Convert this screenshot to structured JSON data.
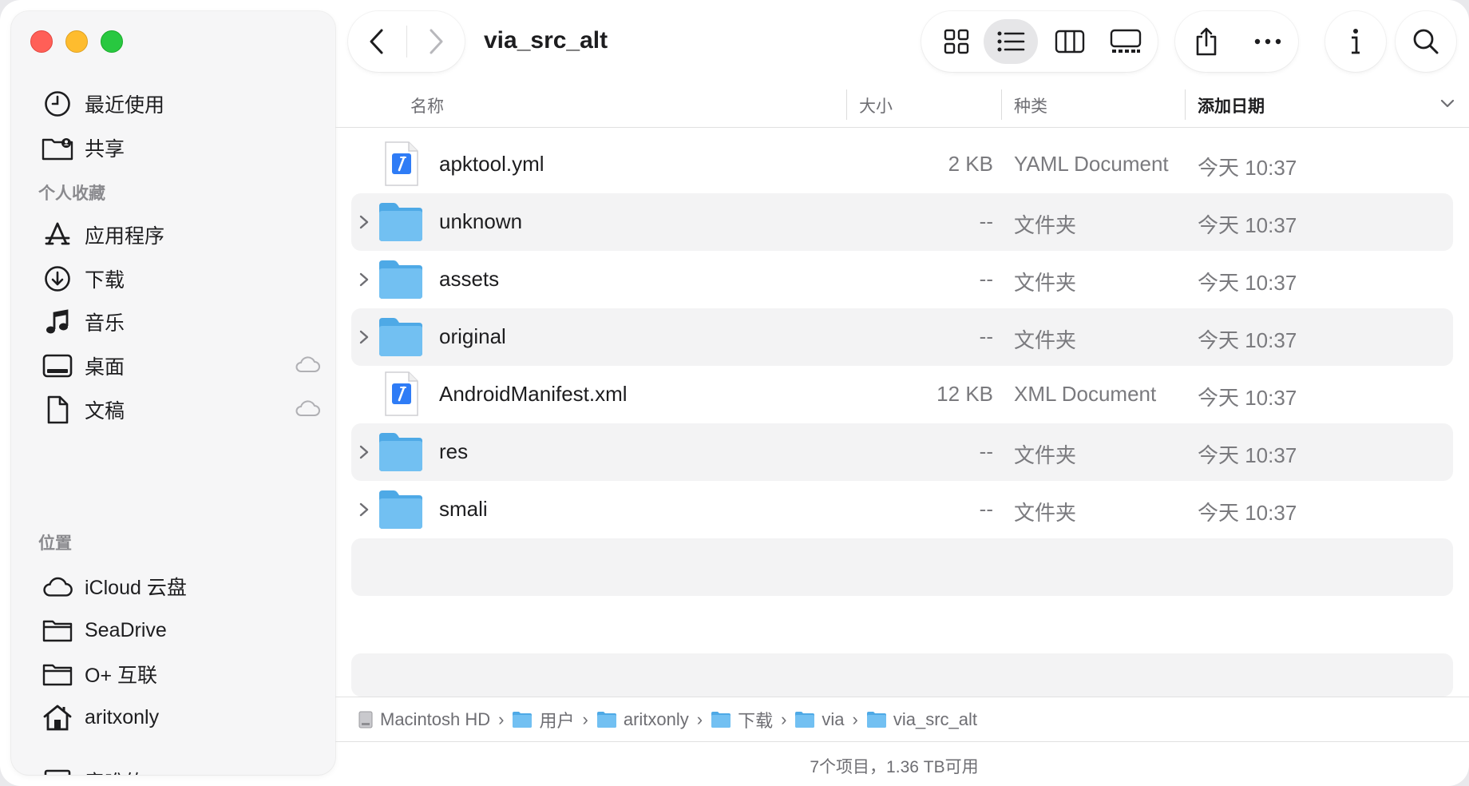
{
  "window": {
    "title": "via_src_alt"
  },
  "sidebar": {
    "top_items": [
      {
        "label": "最近使用",
        "icon": "clock-icon"
      },
      {
        "label": "共享",
        "icon": "shared-folder-icon"
      }
    ],
    "favorites_heading": "个人收藏",
    "favorites": [
      {
        "label": "应用程序",
        "icon": "applications-icon"
      },
      {
        "label": "下载",
        "icon": "download-icon"
      },
      {
        "label": "音乐",
        "icon": "music-icon"
      },
      {
        "label": "桌面",
        "icon": "desktop-icon",
        "cloud": true
      },
      {
        "label": "文稿",
        "icon": "document-icon",
        "cloud": true
      }
    ],
    "locations_heading": "位置",
    "locations": [
      {
        "label": "iCloud 云盘",
        "icon": "cloud-icon"
      },
      {
        "label": "SeaDrive",
        "icon": "folder-icon"
      },
      {
        "label": "O+ 互联",
        "icon": "folder-icon"
      },
      {
        "label": "aritxonly",
        "icon": "home-icon"
      },
      {
        "label": "音唯的MacBook Pro",
        "icon": "laptop-icon"
      }
    ]
  },
  "columns": {
    "name": "名称",
    "size": "大小",
    "kind": "种类",
    "date": "添加日期"
  },
  "files": [
    {
      "name": "apktool.yml",
      "size": "2 KB",
      "kind": "YAML Document",
      "date": "今天 10:37",
      "type": "doc"
    },
    {
      "name": "unknown",
      "size": "--",
      "kind": "文件夹",
      "date": "今天 10:37",
      "type": "folder"
    },
    {
      "name": "assets",
      "size": "--",
      "kind": "文件夹",
      "date": "今天 10:37",
      "type": "folder"
    },
    {
      "name": "original",
      "size": "--",
      "kind": "文件夹",
      "date": "今天 10:37",
      "type": "folder"
    },
    {
      "name": "AndroidManifest.xml",
      "size": "12 KB",
      "kind": "XML Document",
      "date": "今天 10:37",
      "type": "doc"
    },
    {
      "name": "res",
      "size": "--",
      "kind": "文件夹",
      "date": "今天 10:37",
      "type": "folder"
    },
    {
      "name": "smali",
      "size": "--",
      "kind": "文件夹",
      "date": "今天 10:37",
      "type": "folder"
    }
  ],
  "path": [
    "Macintosh HD",
    "用户",
    "aritxonly",
    "下载",
    "via",
    "via_src_alt"
  ],
  "status": "7个项目，1.36 TB可用",
  "colors": {
    "folder": "#5fb5ec",
    "accent": "#2f7cf6"
  }
}
